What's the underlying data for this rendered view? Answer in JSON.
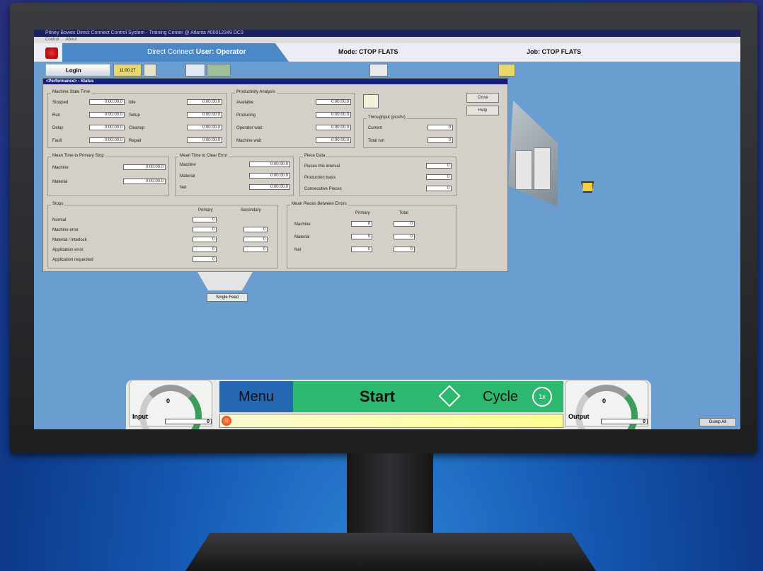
{
  "window": {
    "title": "Pitney Bowes Direct Connect Control System - Training Center @ Atlanta #00012349 DC3",
    "menu": [
      "Control",
      "About"
    ]
  },
  "header": {
    "brand": "Direct Connect",
    "user": "User: Operator",
    "mode": "Mode: CTOP FLATS",
    "job": "Job: CTOP FLATS"
  },
  "toolbar": {
    "login": "Login",
    "counter": "11:00:27"
  },
  "dialog": {
    "title": "<Performance> - Status",
    "close": "Close",
    "help": "Help",
    "machine_state": {
      "title": "Machine State Time",
      "left": [
        {
          "label": "Stopped",
          "value": "0:00:00.0"
        },
        {
          "label": "Run",
          "value": "0:00:00.0"
        },
        {
          "label": "Delay",
          "value": "0:00:00.0"
        },
        {
          "label": "Fault",
          "value": "0:00:00.0"
        }
      ],
      "right": [
        {
          "label": "Idle",
          "value": "0:00:00.0"
        },
        {
          "label": "Setup",
          "value": "0:00:00.0"
        },
        {
          "label": "Cleanup",
          "value": "0:00:00.0"
        },
        {
          "label": "Repair",
          "value": "0:00:00.0"
        }
      ]
    },
    "productivity": {
      "title": "Productivity Analysis",
      "rows": [
        {
          "label": "Available",
          "value": "0:00:00.0"
        },
        {
          "label": "Producing",
          "value": "0:00:00.0"
        },
        {
          "label": "Operator wait",
          "value": "0:00:00.0"
        },
        {
          "label": "Machine wait",
          "value": "0:00:00.0"
        }
      ]
    },
    "throughput": {
      "title": "Throughput (pcs/hr)",
      "rows": [
        {
          "label": "Current",
          "value": "0"
        },
        {
          "label": "Total run",
          "value": "0"
        }
      ]
    },
    "mttps": {
      "title": "Mean Time to Primary Stop",
      "rows": [
        {
          "label": "Machine",
          "value": "0:00:00.0"
        },
        {
          "label": "Material",
          "value": "0:00:00.0"
        }
      ]
    },
    "mttce": {
      "title": "Mean Time to Clear Error",
      "rows": [
        {
          "label": "Machine",
          "value": "0:00:00.0"
        },
        {
          "label": "Material",
          "value": "0:00:00.0"
        },
        {
          "label": "Net",
          "value": "0:00:00.0"
        }
      ]
    },
    "piece": {
      "title": "Piece Data",
      "rows": [
        {
          "label": "Pieces this interval",
          "value": "0"
        },
        {
          "label": "Production basis",
          "value": "0"
        },
        {
          "label": "Consecutive Pieces",
          "value": "0"
        }
      ]
    },
    "stops": {
      "title": "Stops",
      "col_primary": "Primary",
      "col_secondary": "Secondary",
      "rows": [
        {
          "label": "Normal",
          "p": "0",
          "s": ""
        },
        {
          "label": "Machine error",
          "p": "0",
          "s": "0"
        },
        {
          "label": "Material / interlock",
          "p": "0",
          "s": "0"
        },
        {
          "label": "Application error",
          "p": "0",
          "s": "0"
        },
        {
          "label": "Application requested",
          "p": "0",
          "s": ""
        }
      ]
    },
    "mpbe": {
      "title": "Mean Pieces Between Errors",
      "col_primary": "Primary",
      "col_total": "Total",
      "rows": [
        {
          "label": "Machine",
          "p": "0",
          "t": "0"
        },
        {
          "label": "Material",
          "p": "0",
          "t": "0"
        },
        {
          "label": "Net",
          "p": "0",
          "t": "0"
        }
      ]
    }
  },
  "single_feed": "Single Feed",
  "bottom": {
    "input_label": "Input",
    "input_gauge": "0",
    "input_count": "0",
    "menu": "Menu",
    "start": "Start",
    "cycle": "Cycle",
    "cycle_badge": "1x",
    "output_label": "Output",
    "output_gauge": "0",
    "output_count": "0"
  },
  "dump_all": "Dump All"
}
